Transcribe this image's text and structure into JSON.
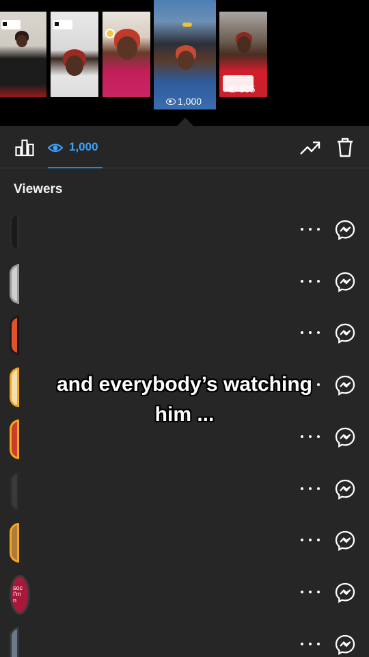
{
  "stories": [
    {
      "id": "story-1",
      "views": ""
    },
    {
      "id": "story-2",
      "views": ""
    },
    {
      "id": "story-3",
      "views": ""
    },
    {
      "id": "story-4",
      "views": "1,000"
    },
    {
      "id": "story-5",
      "views": "805"
    }
  ],
  "toolbar": {
    "views_count": "1,000",
    "icons": [
      "bar-chart-icon",
      "eye-icon",
      "trending-icon",
      "trash-icon"
    ],
    "accent_color": "#0095f6"
  },
  "viewers": {
    "title": "Viewers",
    "rows": [
      {
        "avatar_color": "#1a1a1a",
        "ring": "#2a2a2a"
      },
      {
        "avatar_color": "#cfcfcf",
        "ring": "#9a9a9a"
      },
      {
        "avatar_color": "#e0532a",
        "ring": "#1a1a1a"
      },
      {
        "avatar_color": "#f3e0b0",
        "ring": "#f5a623"
      },
      {
        "avatar_color": "#c8402a",
        "ring": "#f5a623"
      },
      {
        "avatar_color": "#3a3a3a",
        "ring": "#2a2a2a"
      },
      {
        "avatar_color": "#b07a3a",
        "ring": "#f5a623"
      },
      {
        "avatar_color": "#a8183b",
        "ring": "#3a3a3a",
        "label": "soc\nI'm\nn"
      },
      {
        "avatar_color": "#6a7a8a",
        "ring": "#3a3a3a"
      }
    ]
  },
  "caption": {
    "line1": "and everybody’s watching",
    "line2": "him ..."
  }
}
